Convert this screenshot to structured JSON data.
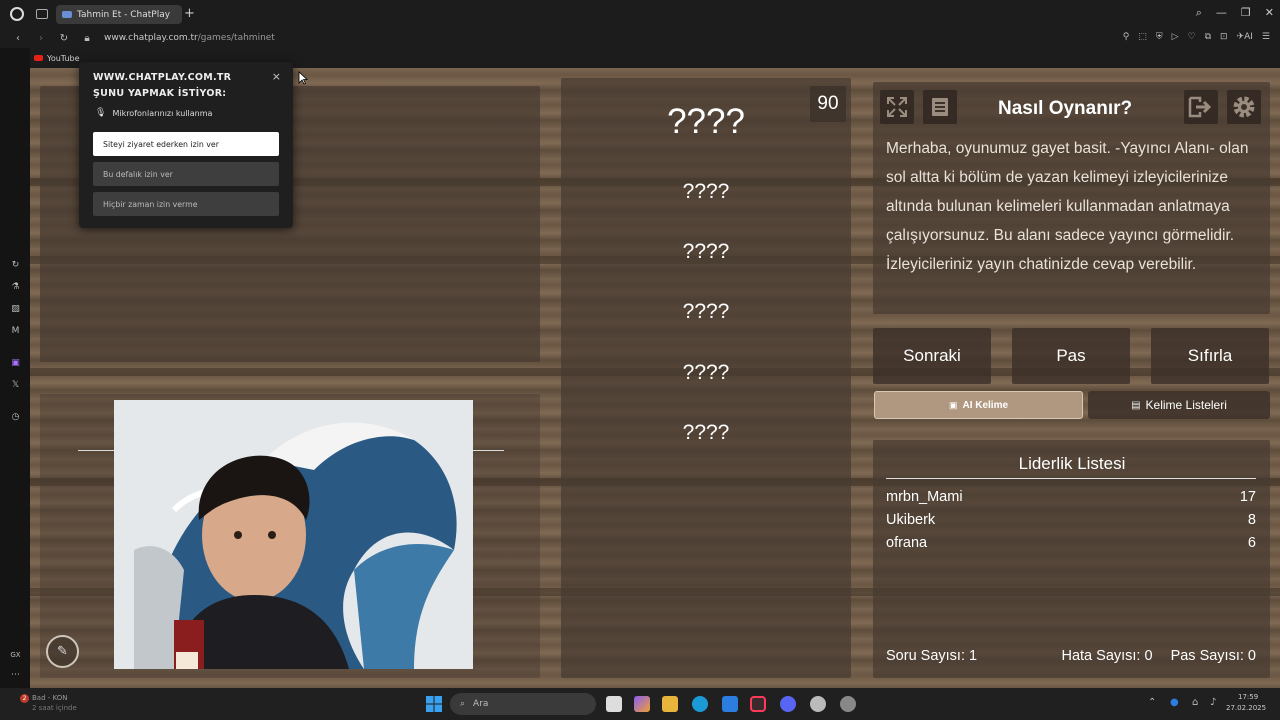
{
  "browser": {
    "tab_title": "Tahmin Et - ChatPlay",
    "new_tab": "+",
    "url_host": "www.chatplay.com.tr",
    "url_path": "/games/tahminet",
    "bookmark_youtube": "YouTube",
    "ai_label": "AI",
    "sidebar_gx": "GX"
  },
  "permission_popup": {
    "title": "WWW.CHATPLAY.COM.TR ŞUNU YAPMAK İSTİYOR:",
    "permission": "Mikrofonlarınızı kullanma",
    "allow_visit": "Siteyi ziyaret ederken izin ver",
    "allow_once": "Bu defalık izin ver",
    "never_allow": "Hiçbir zaman izin verme",
    "close": "×"
  },
  "game": {
    "timer": "90",
    "main_word": "????",
    "words": [
      "????",
      "????",
      "????",
      "????",
      "????"
    ],
    "help_title": "Nasıl Oynanır?",
    "help_text": "Merhaba, oyunumuz gayet basit. -Yayıncı Alanı- olan sol altta ki bölüm de yazan kelimeyi izleyicilerinize altında bulunan kelimeleri kullanmadan anlatmaya çalışıyorsunuz. Bu alanı sadece yayıncı görmelidir. İzleyicileriniz yayın chatinizde cevap verebilir.",
    "buttons": {
      "next": "Sonraki",
      "pass": "Pas",
      "reset": "Sıfırla"
    },
    "ai_word": "AI Kelime",
    "word_lists": "Kelime Listeleri",
    "leaderboard": {
      "title": "Liderlik Listesi",
      "rows": [
        {
          "name": "mrbn_Mami",
          "score": "17"
        },
        {
          "name": "Ukiberk",
          "score": "8"
        },
        {
          "name": "ofrana",
          "score": "6"
        }
      ]
    },
    "stats": {
      "questions": "Soru Sayısı: 1",
      "errors": "Hata Sayısı: 0",
      "passes": "Pas Sayısı: 0"
    }
  },
  "taskbar": {
    "search_placeholder": "Ara",
    "notification": "Bad - KON",
    "notification_sub": "2 saat içinde",
    "notification_count": "2",
    "time": "17:59",
    "date": "27.02.2025"
  }
}
